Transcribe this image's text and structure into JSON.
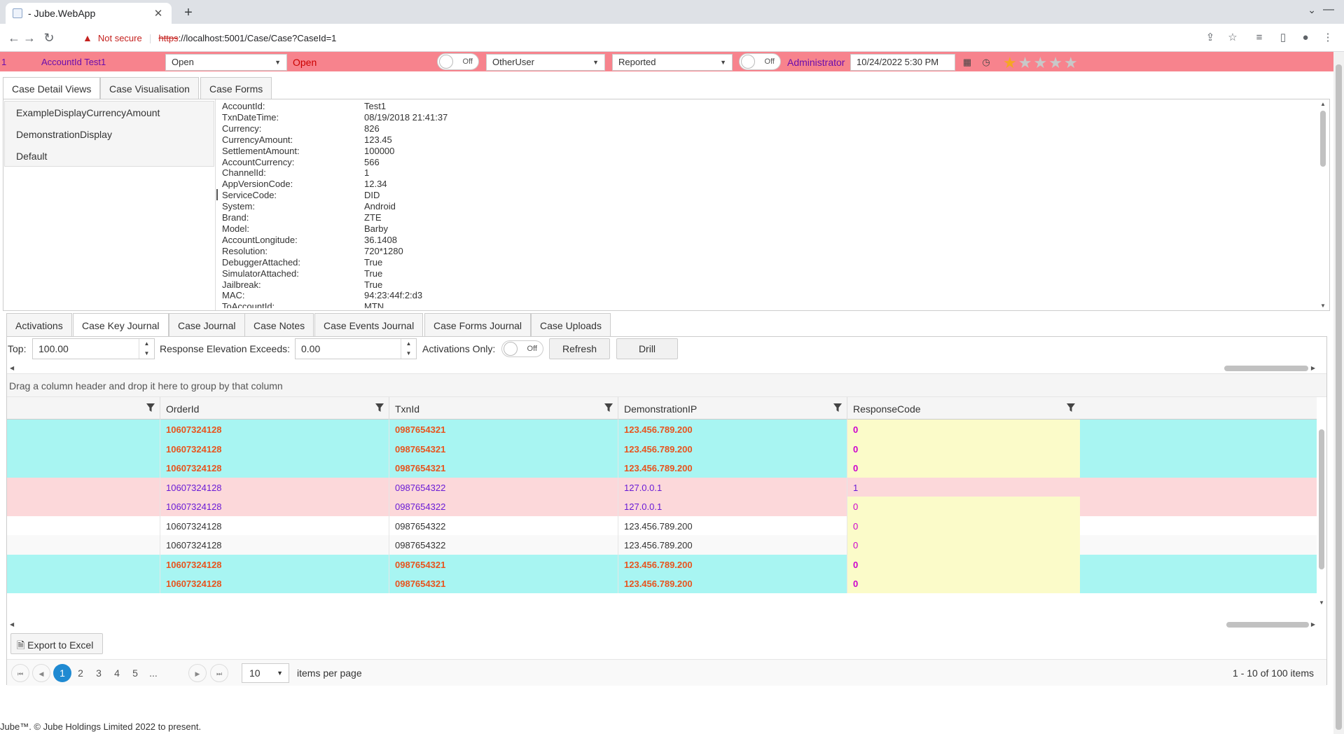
{
  "browser": {
    "tab_title": "- Jube.WebApp",
    "not_secure": "Not secure",
    "url_scheme": "https",
    "url_rest": "://localhost:5001/Case/Case?CaseId=1"
  },
  "case_bar": {
    "case_id": "1",
    "account_label": "AccountId  Test1",
    "status_select": "Open",
    "status_text": "Open",
    "toggle1": "Off",
    "user_select": "OtherUser",
    "workflow_select": "Reported",
    "toggle2": "Off",
    "locked_user": "Administrator",
    "datetime": "10/24/2022 5:30 PM",
    "rating": 1,
    "rating_max": 5
  },
  "main_tabs": [
    "Case Detail Views",
    "Case Visualisation",
    "Case Forms"
  ],
  "views": [
    "ExampleDisplayCurrencyAmount",
    "DemonstrationDisplay",
    "Default"
  ],
  "details": [
    {
      "k": "AccountId:",
      "v": "Test1"
    },
    {
      "k": "TxnDateTime:",
      "v": "08/19/2018 21:41:37"
    },
    {
      "k": "Currency:",
      "v": "826"
    },
    {
      "k": "CurrencyAmount:",
      "v": "123.45"
    },
    {
      "k": "SettlementAmount:",
      "v": "100000"
    },
    {
      "k": "AccountCurrency:",
      "v": "566"
    },
    {
      "k": "ChannelId:",
      "v": "1"
    },
    {
      "k": "AppVersionCode:",
      "v": "12.34"
    },
    {
      "k": "ServiceCode:",
      "v": "DID"
    },
    {
      "k": "System:",
      "v": "Android"
    },
    {
      "k": "Brand:",
      "v": "ZTE"
    },
    {
      "k": "Model:",
      "v": "Barby"
    },
    {
      "k": "AccountLongitude:",
      "v": "36.1408"
    },
    {
      "k": "Resolution:",
      "v": "720*1280"
    },
    {
      "k": "DebuggerAttached:",
      "v": "True"
    },
    {
      "k": "SimulatorAttached:",
      "v": "True"
    },
    {
      "k": "Jailbreak:",
      "v": "True"
    },
    {
      "k": "MAC:",
      "v": "94:23:44f:2:d3"
    },
    {
      "k": "ToAccountId:",
      "v": "MTN"
    }
  ],
  "lower_tabs": [
    "Activations",
    "Case Key Journal",
    "Case Journal",
    "Case Notes",
    "Case Events Journal",
    "Case Forms Journal",
    "Case Uploads"
  ],
  "toolbar": {
    "top_label": "Top:",
    "top_value": "100.00",
    "elevation_label": "Response Elevation Exceeds:",
    "elevation_value": "0.00",
    "activations_label": "Activations Only:",
    "activations_toggle": "Off",
    "refresh": "Refresh",
    "drill": "Drill"
  },
  "group_hint": "Drag a column header and drop it here to group by that column",
  "columns": [
    "",
    "OrderId",
    "TxnId",
    "DemonstrationIP",
    "ResponseCode"
  ],
  "rows": [
    {
      "style": "activation",
      "cells": [
        "",
        "10607324128",
        "0987654321",
        "123.456.789.200",
        "0"
      ]
    },
    {
      "style": "activation",
      "cells": [
        "",
        "10607324128",
        "0987654321",
        "123.456.789.200",
        "0"
      ]
    },
    {
      "style": "activation",
      "cells": [
        "",
        "10607324128",
        "0987654321",
        "123.456.789.200",
        "0"
      ]
    },
    {
      "style": "pink",
      "cells": [
        "",
        "10607324128",
        "0987654322",
        "127.0.0.1",
        "1"
      ]
    },
    {
      "style": "pink-yellow",
      "cells": [
        "",
        "10607324128",
        "0987654322",
        "127.0.0.1",
        "0"
      ]
    },
    {
      "style": "plain",
      "cells": [
        "",
        "10607324128",
        "0987654322",
        "123.456.789.200",
        "0"
      ]
    },
    {
      "style": "plain",
      "cells": [
        "",
        "10607324128",
        "0987654322",
        "123.456.789.200",
        "0"
      ]
    },
    {
      "style": "activation",
      "cells": [
        "",
        "10607324128",
        "0987654321",
        "123.456.789.200",
        "0"
      ]
    },
    {
      "style": "activation",
      "cells": [
        "",
        "10607324128",
        "0987654321",
        "123.456.789.200",
        "0"
      ]
    }
  ],
  "row_colors": {
    "activation_bg": "#a8f5f2",
    "activation_text": "#e8541e",
    "pink_bg": "#fcd8da",
    "pink_text": "#6a1bd6",
    "yellow_bg": "#fbfbc9",
    "code_text": "#cc00cc",
    "plain_text": "#333333"
  },
  "export_label": "Export to Excel",
  "pager": {
    "pages": [
      "1",
      "2",
      "3",
      "4",
      "5",
      "..."
    ],
    "active": "1",
    "page_size": "10",
    "items_per_page": "items per page",
    "info": "1 - 10 of 100 items"
  },
  "footer": "Jube™. © Jube Holdings Limited 2022 to present."
}
